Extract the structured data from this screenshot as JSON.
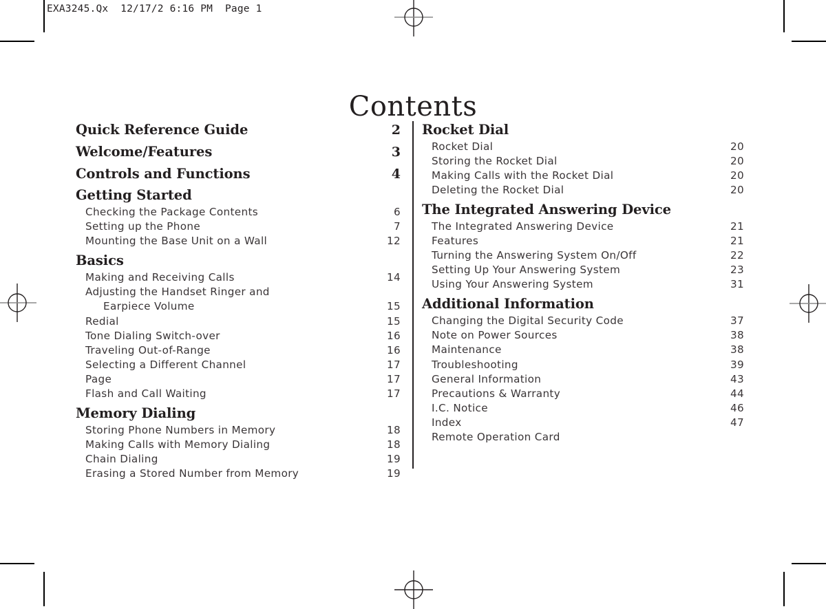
{
  "header_slug": "EXA3245.Qx  12/17/2 6:16 PM  Page 1",
  "page_title": "Contents",
  "columns": {
    "left": [
      {
        "type": "heading",
        "label": "Quick Reference Guide",
        "page": "2"
      },
      {
        "type": "heading",
        "label": "Welcome/Features",
        "page": "3"
      },
      {
        "type": "heading",
        "label": "Controls and Functions",
        "page": "4"
      },
      {
        "type": "heading",
        "label": "Getting Started",
        "page": ""
      },
      {
        "type": "sub",
        "label": "Checking the Package Contents",
        "page": "6"
      },
      {
        "type": "sub",
        "label": "Setting up the Phone",
        "page": "7"
      },
      {
        "type": "sub",
        "label": "Mounting the Base Unit on a Wall",
        "page": "12"
      },
      {
        "type": "heading",
        "label": "Basics",
        "page": ""
      },
      {
        "type": "sub",
        "label": "Making and Receiving Calls",
        "page": "14"
      },
      {
        "type": "sub",
        "label": "Adjusting the Handset Ringer and",
        "page": ""
      },
      {
        "type": "sub-cont",
        "label": "Earpiece Volume",
        "page": "15"
      },
      {
        "type": "sub",
        "label": "Redial",
        "page": "15"
      },
      {
        "type": "sub",
        "label": "Tone Dialing Switch-over",
        "page": "16"
      },
      {
        "type": "sub",
        "label": "Traveling Out-of-Range",
        "page": "16"
      },
      {
        "type": "sub",
        "label": "Selecting a Different Channel",
        "page": "17"
      },
      {
        "type": "sub",
        "label": "Page",
        "page": "17"
      },
      {
        "type": "sub",
        "label": "Flash and Call Waiting",
        "page": "17"
      },
      {
        "type": "heading",
        "label": "Memory Dialing",
        "page": ""
      },
      {
        "type": "sub",
        "label": "Storing Phone Numbers in Memory",
        "page": "18"
      },
      {
        "type": "sub",
        "label": "Making Calls with Memory Dialing",
        "page": "18"
      },
      {
        "type": "sub",
        "label": "Chain Dialing",
        "page": "19"
      },
      {
        "type": "sub",
        "label": "Erasing a Stored Number from Memory",
        "page": "19"
      }
    ],
    "right": [
      {
        "type": "heading",
        "label": "Rocket Dial",
        "page": ""
      },
      {
        "type": "sub",
        "label": "Rocket Dial",
        "page": "20"
      },
      {
        "type": "sub",
        "label": "Storing the Rocket Dial",
        "page": "20"
      },
      {
        "type": "sub",
        "label": "Making Calls with the Rocket Dial",
        "page": "20"
      },
      {
        "type": "sub",
        "label": "Deleting the Rocket Dial",
        "page": "20"
      },
      {
        "type": "heading",
        "label": "The Integrated Answering Device",
        "page": ""
      },
      {
        "type": "sub",
        "label": "The Integrated Answering Device",
        "page": "21"
      },
      {
        "type": "sub",
        "label": "Features",
        "page": "21"
      },
      {
        "type": "sub",
        "label": "Turning the Answering System On/Off",
        "page": "22"
      },
      {
        "type": "sub",
        "label": "Setting Up Your Answering System",
        "page": "23"
      },
      {
        "type": "sub",
        "label": "Using Your Answering System",
        "page": "31"
      },
      {
        "type": "heading",
        "label": "Additional Information",
        "page": ""
      },
      {
        "type": "sub",
        "label": "Changing the Digital Security Code",
        "page": "37"
      },
      {
        "type": "sub",
        "label": "Note on Power Sources",
        "page": "38"
      },
      {
        "type": "sub",
        "label": "Maintenance",
        "page": "38"
      },
      {
        "type": "sub",
        "label": "Troubleshooting",
        "page": "39"
      },
      {
        "type": "sub",
        "label": "General Information",
        "page": "43"
      },
      {
        "type": "sub",
        "label": "Precautions & Warranty",
        "page": "44"
      },
      {
        "type": "sub",
        "label": "I.C. Notice",
        "page": "46"
      },
      {
        "type": "sub",
        "label": "Index",
        "page": "47"
      },
      {
        "type": "sub",
        "label": "Remote Operation Card",
        "page": ""
      }
    ]
  },
  "print_marks": {
    "registration_marks": [
      "reg-mark-top",
      "reg-mark-bottom",
      "reg-mark-left",
      "reg-mark-right"
    ],
    "crop_marks": [
      "crop-mark-top-left",
      "crop-mark-top-right",
      "crop-mark-bottom-left",
      "crop-mark-bottom-right"
    ]
  },
  "colors": {
    "text": "#231f20",
    "body_text": "#3a3537",
    "rule": "#231f20",
    "background": "#ffffff"
  }
}
